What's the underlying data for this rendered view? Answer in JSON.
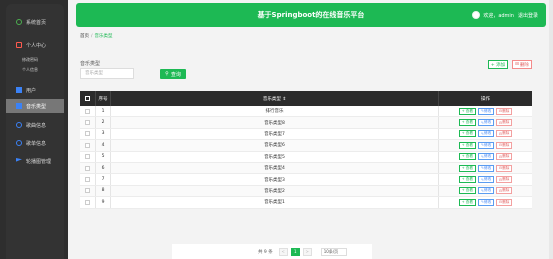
{
  "sidebar": {
    "items": [
      {
        "label": "系统首页",
        "icon": "home-icon"
      },
      {
        "label": "个人中心",
        "icon": "user-icon"
      },
      {
        "label": "修改密码"
      },
      {
        "label": "个人信息"
      },
      {
        "label": "用户",
        "icon": "grid-icon"
      },
      {
        "label": "音乐类型",
        "icon": "grid-icon"
      },
      {
        "label": "歌曲信息",
        "icon": "disc-icon"
      },
      {
        "label": "歌单信息",
        "icon": "disc-icon"
      },
      {
        "label": "轮播图管理",
        "icon": "flag-icon"
      }
    ]
  },
  "header": {
    "title": "基于Springboot的在线音乐平台",
    "welcome": "欢迎，admin",
    "logout": "退出登录"
  },
  "breadcrumb": {
    "home": "首页",
    "current": "音乐类型"
  },
  "search": {
    "label": "音乐类型",
    "placeholder": "音乐类型",
    "button": "查询"
  },
  "actions": {
    "add": "+ 添加",
    "delete": "删除"
  },
  "table": {
    "headers": {
      "index": "序号",
      "name": "音乐类型 ⇕",
      "ops": "操作"
    },
    "op_labels": {
      "view": "+ 查看",
      "edit": "修改",
      "delete": "删除"
    },
    "rows": [
      {
        "index": "1",
        "name": "排行音乐"
      },
      {
        "index": "2",
        "name": "音乐类型8"
      },
      {
        "index": "3",
        "name": "音乐类型7"
      },
      {
        "index": "4",
        "name": "音乐类型6"
      },
      {
        "index": "5",
        "name": "音乐类型5"
      },
      {
        "index": "6",
        "name": "音乐类型4"
      },
      {
        "index": "7",
        "name": "音乐类型3"
      },
      {
        "index": "8",
        "name": "音乐类型2"
      },
      {
        "index": "9",
        "name": "音乐类型1"
      }
    ]
  },
  "pagination": {
    "total": "共 9 条",
    "prev": "<",
    "page": "1",
    "next": ">",
    "page_size": "10条/页"
  },
  "colors": {
    "accent": "#1db954",
    "sidebar": "#2e2e2e",
    "table_header": "#2b2b2b"
  }
}
